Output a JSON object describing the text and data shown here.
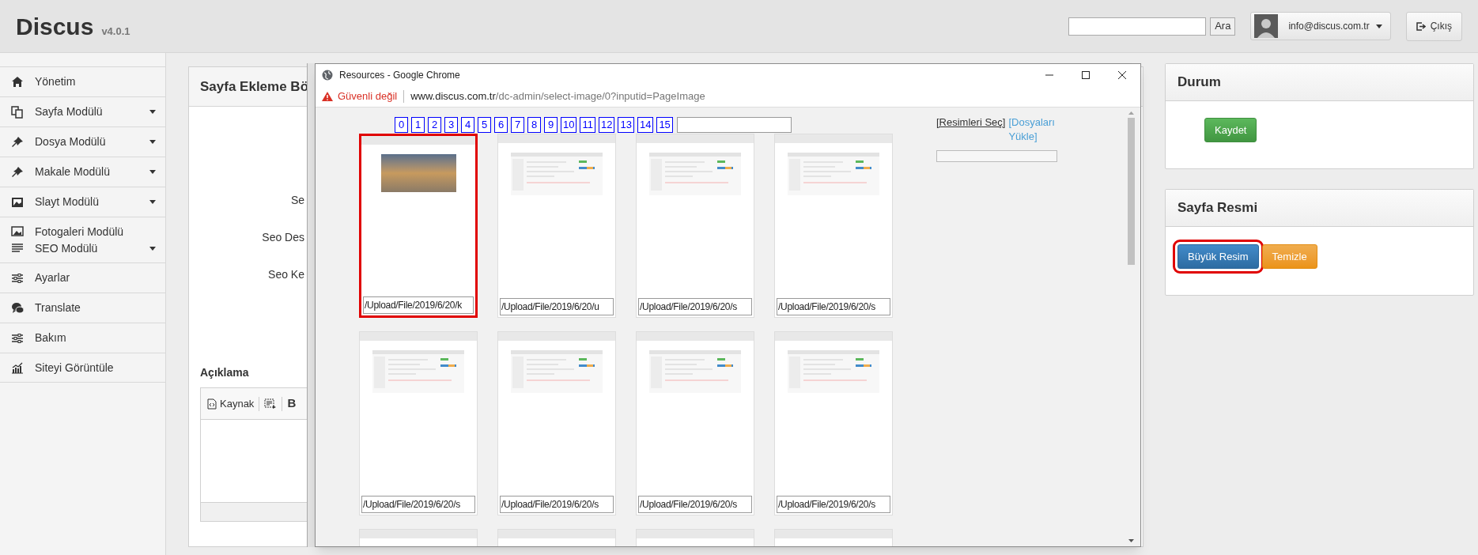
{
  "header": {
    "title": "Discus",
    "version": "v4.0.1",
    "search_button": "Ara",
    "user_email": "info@discus.com.tr",
    "logout_button": "Çıkış"
  },
  "sidebar": {
    "groups": [
      [
        {
          "label": "Yönetim",
          "expandable": false
        }
      ],
      [
        {
          "label": "Sayfa Modülü",
          "expandable": true
        }
      ],
      [
        {
          "label": "Dosya Modülü",
          "expandable": true
        }
      ],
      [
        {
          "label": "Makale Modülü",
          "expandable": true
        }
      ],
      [
        {
          "label": "Slayt Modülü",
          "expandable": true
        }
      ],
      [
        {
          "label": "Fotogaleri Modülü",
          "expandable": false
        },
        {
          "label": "SEO Modülü",
          "expandable": true
        }
      ],
      [
        {
          "label": "Ayarlar",
          "expandable": false
        }
      ],
      [
        {
          "label": "Translate",
          "expandable": false
        }
      ],
      [
        {
          "label": "Bakım",
          "expandable": false
        }
      ],
      [
        {
          "label": "Siteyi Görüntüle",
          "expandable": false
        }
      ]
    ]
  },
  "main_form": {
    "title": "Sayfa Ekleme Bö",
    "labels": [
      "Se",
      "Seo Des",
      "Seo Ke"
    ],
    "description_label": "Açıklama",
    "editor_toolbar": {
      "source_button": "Kaynak",
      "bold_button": "B"
    }
  },
  "popup": {
    "title": "Resources - Google Chrome",
    "security_warning": "Güvenli değil",
    "url_host": "www.discus.com.tr",
    "url_path": "/dc-admin/select-image/0?inputid=PageImage",
    "pages": [
      "0",
      "1",
      "2",
      "3",
      "4",
      "5",
      "6",
      "7",
      "8",
      "9",
      "10",
      "11",
      "12",
      "13",
      "14",
      "15"
    ],
    "links": [
      {
        "label": "[Resimleri Seç]",
        "kind": "current"
      },
      {
        "label": "[Dosyaları Yükle]",
        "kind": "link"
      }
    ],
    "images": [
      {
        "path": "/Upload/File/2019/6/20/k",
        "kind": "photo",
        "selected": true
      },
      {
        "path": "/Upload/File/2019/6/20/u",
        "kind": "screenshot",
        "selected": false
      },
      {
        "path": "/Upload/File/2019/6/20/s",
        "kind": "screenshot",
        "selected": false
      },
      {
        "path": "/Upload/File/2019/6/20/s",
        "kind": "screenshot",
        "selected": false
      },
      {
        "path": "/Upload/File/2019/6/20/s",
        "kind": "screenshot",
        "selected": false
      },
      {
        "path": "/Upload/File/2019/6/20/s",
        "kind": "screenshot",
        "selected": false
      },
      {
        "path": "/Upload/File/2019/6/20/s",
        "kind": "screenshot",
        "selected": false
      },
      {
        "path": "/Upload/File/2019/6/20/s",
        "kind": "screenshot",
        "selected": false
      },
      {
        "kind": "blank",
        "selected": false
      },
      {
        "kind": "blank",
        "selected": false
      },
      {
        "kind": "blank",
        "selected": false
      },
      {
        "kind": "blank",
        "selected": false
      }
    ]
  },
  "status_card": {
    "title": "Durum",
    "save_button": "Kaydet"
  },
  "image_card": {
    "title": "Sayfa Resmi",
    "buttons": [
      {
        "label": "Büyük Resim",
        "kind": "primary",
        "highlighted": true
      },
      {
        "label": "Temizle",
        "kind": "warning",
        "highlighted": false
      }
    ]
  }
}
